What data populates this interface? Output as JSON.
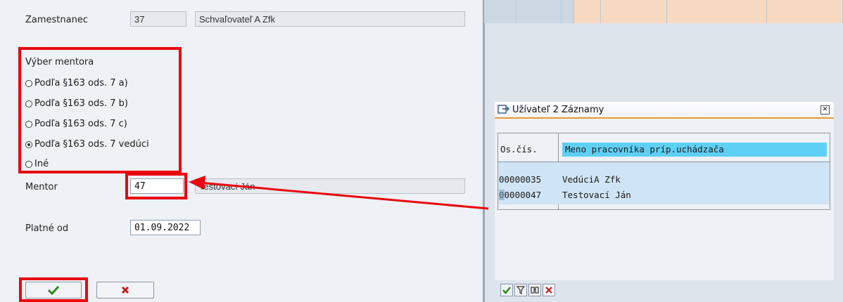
{
  "form": {
    "employee_label": "Zamestnanec",
    "employee_id": "37",
    "employee_name": "Schvaľovateľ A Zfk",
    "mentor_group_title": "Výber mentora",
    "radio_options": [
      {
        "label": "Podľa §163 ods. 7 a)",
        "selected": false
      },
      {
        "label": "Podľa §163 ods. 7 b)",
        "selected": false
      },
      {
        "label": "Podľa §163 ods. 7 c)",
        "selected": false
      },
      {
        "label": "Podľa §163 ods. 7 vedúci",
        "selected": true
      },
      {
        "label": "Iné",
        "selected": false
      }
    ],
    "mentor_label": "Mentor",
    "mentor_id": "47",
    "mentor_name": "Testovací Ján",
    "valid_from_label": "Platné od",
    "valid_from_value": "01.09.2022"
  },
  "buttons": {
    "confirm_icon": "check-icon",
    "cancel_icon": "cancel-icon"
  },
  "popup": {
    "title": "Užívateľ 2 Záznamy",
    "columns": [
      "Os.čís.",
      "Meno pracovníka príp.uchádzača"
    ],
    "rows": [
      {
        "id": "00000035",
        "name": "VedúciA Zfk"
      },
      {
        "id": "00000047",
        "name": "Testovací Ján"
      }
    ],
    "toolbar_icons": [
      "check-icon",
      "filter-icon",
      "find-icon",
      "cancel-icon"
    ]
  },
  "colors": {
    "highlight": "#e8070e",
    "header_cell": "#5fd0f5",
    "selected_row": "#cfe4f4",
    "popup_accent": "#e79b2c"
  }
}
